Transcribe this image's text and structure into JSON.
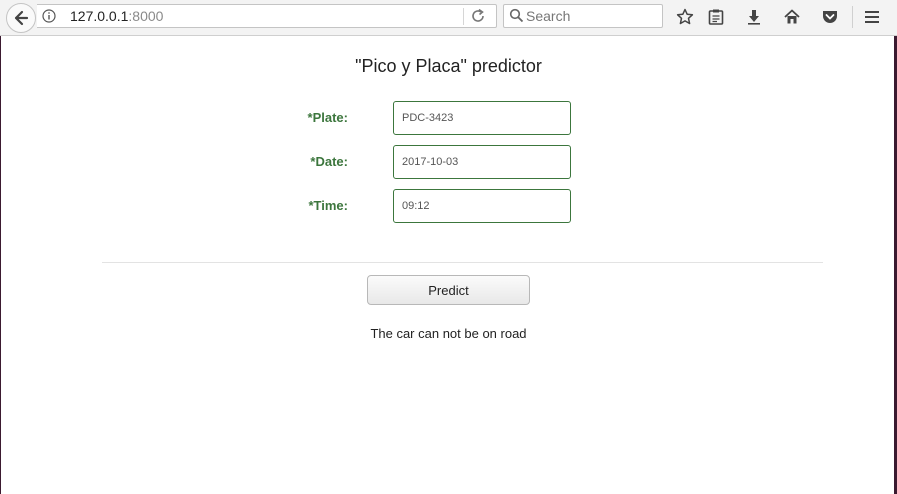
{
  "browser": {
    "url_host": "127.0.0.1",
    "url_port": ":8000",
    "search_placeholder": "Search"
  },
  "page": {
    "title": "\"Pico y Placa\" predictor",
    "fields": [
      {
        "label": "*Plate:",
        "value": "PDC-3423"
      },
      {
        "label": "*Date:",
        "value": "2017-10-03"
      },
      {
        "label": "*Time:",
        "value": "09:12"
      }
    ],
    "predict_label": "Predict",
    "result": "The car can not be on road"
  },
  "icons": [
    "back-arrow-icon",
    "info-icon",
    "reload-icon",
    "search-icon",
    "bookmark-star-icon",
    "reading-list-icon",
    "download-icon",
    "home-icon",
    "pocket-icon",
    "menu-icon"
  ],
  "colors": {
    "label_green": "#3c763d",
    "input_border": "#3c763d"
  }
}
